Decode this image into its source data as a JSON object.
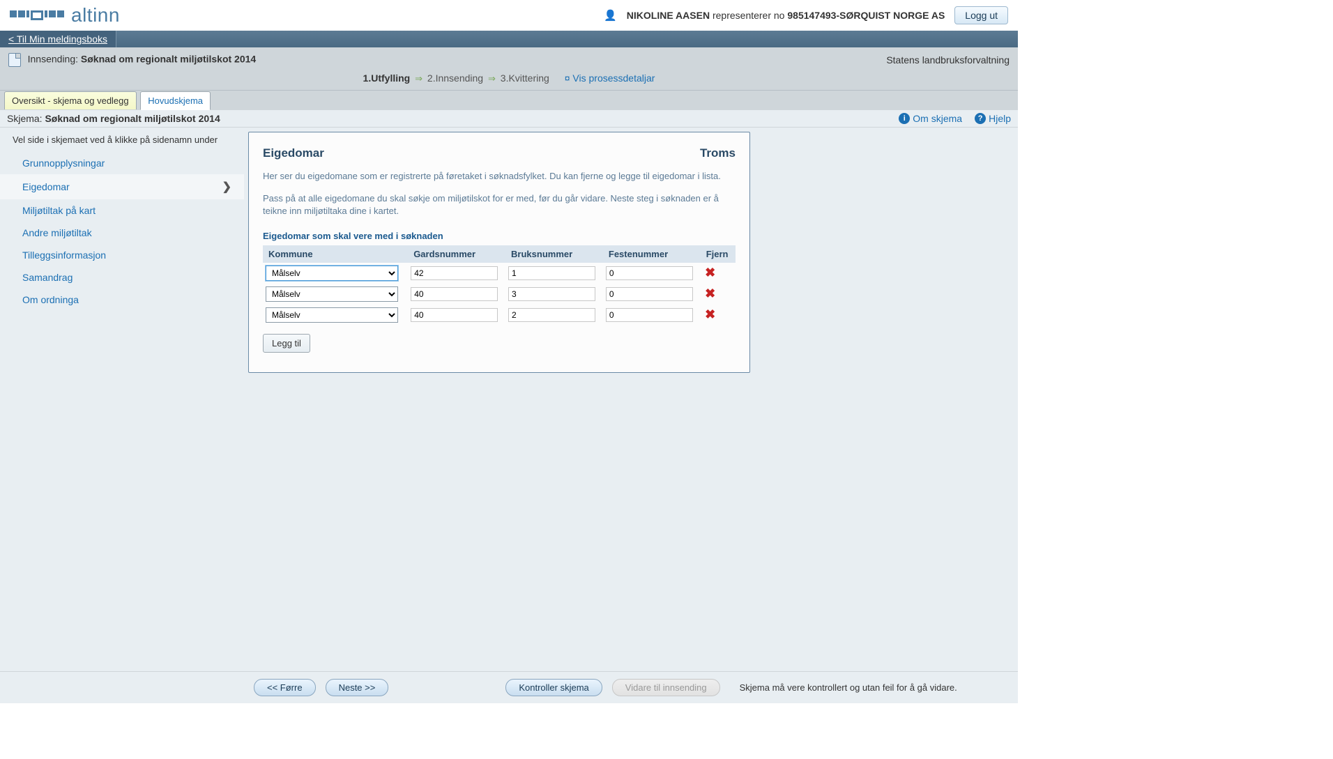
{
  "header": {
    "brand": "altinn",
    "user_name": "NIKOLINE AASEN",
    "represents_text": "representerer no",
    "org": "985147493-SØRQUIST NORGE AS",
    "logout": "Logg ut"
  },
  "toplink": {
    "label": "< Til Min meldingsboks"
  },
  "submission": {
    "prefix": "Innsending:",
    "title": "Søknad om regionalt miljøtilskot 2014",
    "agency": "Statens landbruksforvaltning"
  },
  "process": {
    "step1": "1.Utfylling",
    "step2": "2.Innsending",
    "step3": "3.Kvittering",
    "details_link": "Vis prosessdetaljar"
  },
  "tabs": {
    "tab1": "Oversikt - skjema og vedlegg",
    "tab2": "Hovudskjema"
  },
  "schema_bar": {
    "prefix": "Skjema:",
    "title": "Søknad om regionalt miljøtilskot 2014",
    "about": "Om skjema",
    "help": "Hjelp"
  },
  "sidebar": {
    "intro": "Vel side i skjemaet ved å klikke på sidenamn under",
    "items": [
      {
        "label": "Grunnopplysningar"
      },
      {
        "label": "Eigedomar"
      },
      {
        "label": "Miljøtiltak på kart"
      },
      {
        "label": "Andre miljøtiltak"
      },
      {
        "label": "Tilleggsinformasjon"
      },
      {
        "label": "Samandrag"
      },
      {
        "label": "Om ordninga"
      }
    ]
  },
  "form": {
    "heading": "Eigedomar",
    "region": "Troms",
    "intro1": "Her ser du eigedomane som er registrerte på føretaket i søknadsfylket. Du kan fjerne og legge til eigedomar i lista.",
    "intro2": "Pass på at alle eigedomane du skal søkje om miljøtilskot for er med, før du går vidare. Neste steg i søknaden er å teikne inn miljøtiltaka dine i kartet.",
    "subheading": "Eigedomar som skal vere med i søknaden",
    "columns": {
      "kommune": "Kommune",
      "gard": "Gardsnummer",
      "bruk": "Bruksnummer",
      "feste": "Festenummer",
      "fjern": "Fjern"
    },
    "rows": [
      {
        "kommune": "Målselv",
        "gard": "42",
        "bruk": "1",
        "feste": "0"
      },
      {
        "kommune": "Målselv",
        "gard": "40",
        "bruk": "3",
        "feste": "0"
      },
      {
        "kommune": "Målselv",
        "gard": "40",
        "bruk": "2",
        "feste": "0"
      }
    ],
    "add_button": "Legg til"
  },
  "bottom": {
    "prev": "<< Førre",
    "next": "Neste >>",
    "check": "Kontroller skjema",
    "forward": "Vidare til innsending",
    "note": "Skjema må vere kontrollert og utan feil for å gå vidare."
  }
}
